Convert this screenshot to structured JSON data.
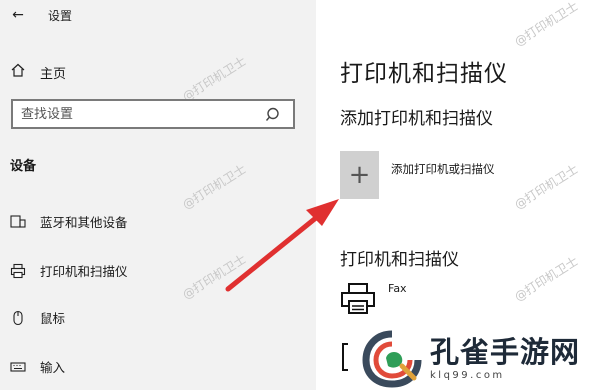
{
  "window": {
    "title": "设置"
  },
  "sidebar": {
    "home_label": "主页",
    "search_placeholder": "查找设置",
    "section_title": "设备",
    "items": [
      {
        "label": "蓝牙和其他设备",
        "icon": "bluetooth-devices-icon"
      },
      {
        "label": "打印机和扫描仪",
        "icon": "printer-icon"
      },
      {
        "label": "鼠标",
        "icon": "mouse-icon"
      },
      {
        "label": "输入",
        "icon": "keyboard-icon"
      }
    ]
  },
  "main": {
    "page_title": "打印机和扫描仪",
    "add_section_title": "添加打印机和扫描仪",
    "add_button_label": "添加打印机或扫描仪",
    "list_section_title": "打印机和扫描仪",
    "devices": [
      {
        "name": "Fax",
        "icon": "fax-printer-icon"
      }
    ]
  },
  "watermark": {
    "text": "@打印机卫士"
  },
  "brand": {
    "name": "孔雀手游网",
    "url": "klq99.com"
  },
  "colors": {
    "arrow": "#e03030",
    "sidebar_bg": "#f2f2f2",
    "tile_bg": "#d0d0d0"
  }
}
